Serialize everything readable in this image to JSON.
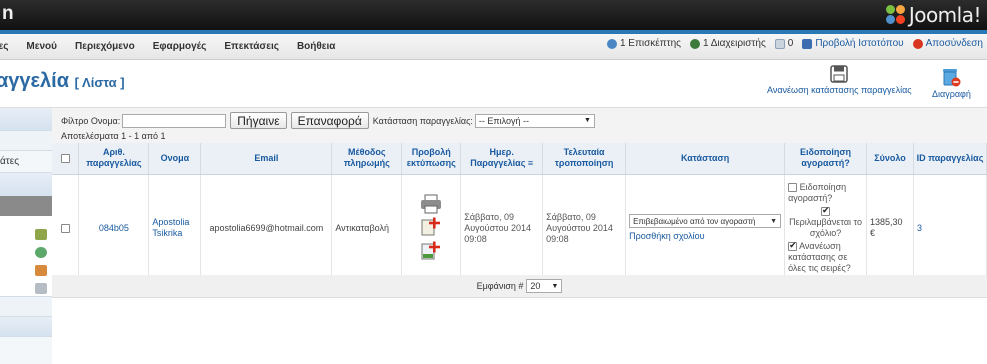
{
  "header": {
    "app_title": "n",
    "logo_text": "Joomla!"
  },
  "menu": {
    "items": [
      "τες",
      "Μενού",
      "Περιεχόμενο",
      "Εφαρμογές",
      "Επεκτάσεις",
      "Βοήθεια"
    ]
  },
  "status": {
    "visitors": "1 Επισκέπτης",
    "admins": "1 Διαχειριστής",
    "messages": "0",
    "view_site": "Προβολή Ιστοτόπου",
    "logout": "Αποσύνδεση"
  },
  "page": {
    "title": "αγγελία",
    "subtitle": "[ Λίστα ]"
  },
  "toolbar": {
    "update_status_label": "Ανανέωση κατάστασης παραγγελίας",
    "delete_label": "Διαγραφή"
  },
  "sidebar": {
    "item_label": "άτες"
  },
  "filter": {
    "name_label": "Φίλτρο Ονομα:",
    "name_value": "",
    "go_label": "Πήγαινε",
    "reset_label": "Επαναφορά",
    "status_label": "Κατάσταση παραγγελίας:",
    "status_value": "-- Επιλογή --",
    "results": "Αποτελέσματα 1 - 1 από 1"
  },
  "table": {
    "columns": [
      "Αριθ. παραγγελίας",
      "Ονομα",
      "Email",
      "Μέθοδος πληρωμής",
      "Προβολή εκτύπωσης",
      "Ημερ. Παραγγελίας",
      "Τελευταία τροποποίηση",
      "Κατάσταση",
      "Ειδοποίηση αγοραστή?",
      "Σύνολο",
      "ID παραγγελίας"
    ],
    "rows": [
      {
        "order_no": "084b05",
        "name": "Apostolia Tsikrika",
        "email": "apostolia6699@hotmail.com",
        "payment": "Αντικαταβολή",
        "order_date": "Σάββατο, 09 Αυγούστου 2014 09:08",
        "modified": "Σάββατο, 09 Αυγούστου 2014 09:08",
        "status_value": "Επιβεβαιωμένο από τον αγοραστή",
        "add_comment": "Προσθήκη σχολίου",
        "notify_label": "Ειδοποίηση αγοραστή?",
        "include_comment": "Περιλαμβάνεται το σχόλιο?",
        "update_all": "Ανανέωση κατάστασης σε όλες τις σειρές?",
        "total": "1385,30 €",
        "order_id": "3"
      }
    ]
  },
  "pagination": {
    "display_label": "Εμφάνιση #",
    "display_value": "20"
  },
  "colors": {
    "accent": "#2a78b5",
    "link": "#1a5aa0",
    "header_bg": "#1a1a1a"
  }
}
